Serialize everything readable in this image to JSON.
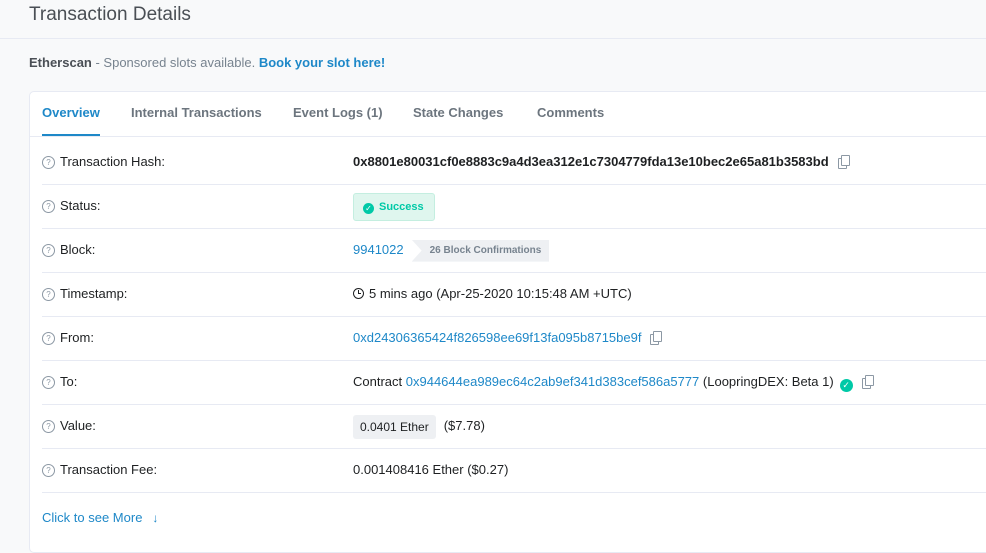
{
  "page": {
    "title": "Transaction Details"
  },
  "sponsor": {
    "brand": "Etherscan",
    "text": " - Sponsored slots available. ",
    "cta": "Book your slot here!"
  },
  "tabs": [
    {
      "label": "Overview",
      "active": true
    },
    {
      "label": "Internal Transactions",
      "active": false
    },
    {
      "label": "Event Logs (1)",
      "active": false
    },
    {
      "label": "State Changes",
      "active": false
    },
    {
      "label": "Comments",
      "active": false
    }
  ],
  "details": {
    "hash": {
      "label": "Transaction Hash:",
      "value": "0x8801e80031cf0e8883c9a4d3ea312e1c7304779fda13e10bec2e65a81b3583bd"
    },
    "status": {
      "label": "Status:",
      "value": "Success"
    },
    "block": {
      "label": "Block:",
      "value": "9941022",
      "confirmations": "26 Block Confirmations"
    },
    "timestamp": {
      "label": "Timestamp:",
      "value": "5 mins ago (Apr-25-2020 10:15:48 AM +UTC)"
    },
    "from": {
      "label": "From:",
      "value": "0xd24306365424f826598ee69f13fa095b8715be9f"
    },
    "to": {
      "label": "To:",
      "prefix": "Contract",
      "address": "0x944644ea989ec64c2ab9ef341d383cef586a5777",
      "name": "(LoopringDEX: Beta 1)"
    },
    "value": {
      "label": "Value:",
      "amount": "0.0401 Ether",
      "usd": "($7.78)"
    },
    "fee": {
      "label": "Transaction Fee:",
      "value": "0.001408416 Ether ($0.27)"
    }
  },
  "more": {
    "label": "Click to see More"
  },
  "icons": {
    "help": "question-circle-icon",
    "copy": "copy-icon",
    "success": "check-circle-icon",
    "clock": "clock-icon",
    "verified": "verified-check-icon",
    "expand": "arrow-down-icon"
  },
  "colors": {
    "link": "#1e88c8",
    "success": "#00c9a7",
    "success_bg": "#dff6ee",
    "border": "#e7eaf3"
  }
}
